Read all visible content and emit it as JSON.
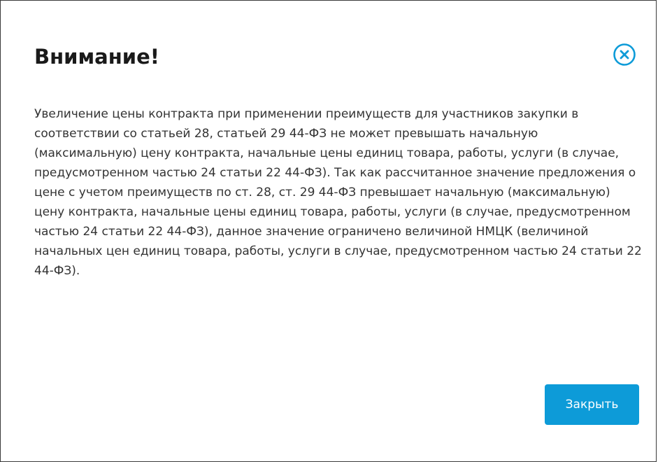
{
  "modal": {
    "title": "Внимание!",
    "close_icon": "close-circle-icon",
    "body_text": "Увеличение цены контракта при применении преимуществ для участников закупки в соответствии со статьей 28, статьей 29 44-ФЗ не может превышать начальную (максимальную) цену контракта, начальные цены единиц товара, работы, услуги (в случае, предусмотренном частью 24 статьи 22 44-ФЗ). Так как рассчитанное значение предложения о цене с учетом преимуществ по ст. 28, ст. 29 44-ФЗ превышает начальную (максимальную) цену контракта, начальные цены единиц товара, работы, услуги (в случае, предусмотренном частью 24 статьи 22 44-ФЗ), данное значение ограничено величиной НМЦК (величиной начальных цен единиц товара, работы, услуги в случае, предусмотренном частью 24 статьи 22 44-ФЗ).",
    "close_button_label": "Закрыть"
  },
  "colors": {
    "accent": "#0d9bd8",
    "title": "#1a1a1a",
    "text": "#333333"
  }
}
